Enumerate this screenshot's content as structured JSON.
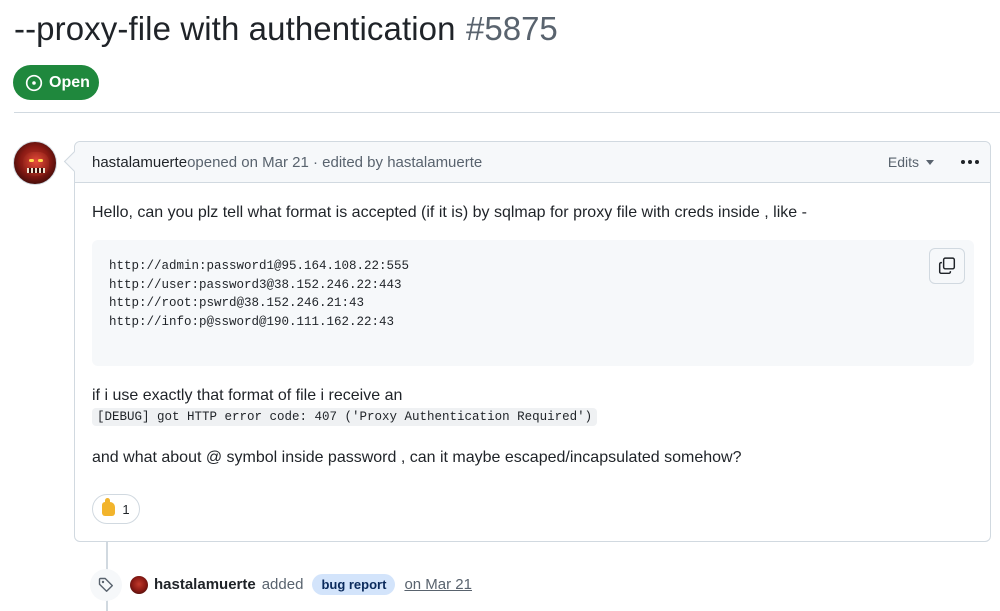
{
  "issue": {
    "title": "--proxy-file with authentication",
    "number": "#5875",
    "state": "Open"
  },
  "comment": {
    "author": "hastalamuerte",
    "meta": " opened on Mar 21 · edited by hastalamuerte",
    "edits_label": "Edits",
    "paragraph1": "Hello, can you plz tell what format is accepted (if it is) by sqlmap for proxy file with creds inside , like -",
    "code_lines": [
      "http://admin:password1@95.164.108.22:555",
      "http://user:password3@38.152.246.22:443",
      "http://root:pswrd@38.152.246.21:43",
      "http://info:p@ssword@190.111.162.22:43"
    ],
    "paragraph2": "if i use exactly that format of file i receive an",
    "inline_code": "[DEBUG] got HTTP error code: 407 ('Proxy Authentication Required')",
    "paragraph3": "and what about @ symbol inside password , can it maybe escaped/incapsulated somehow?",
    "reaction_count": "1"
  },
  "event": {
    "author": "hastalamuerte",
    "action": "added",
    "label": "bug report",
    "date": "on Mar 21"
  },
  "colors": {
    "open_green": "#1f883d",
    "label_bg": "#d3e4fb",
    "border": "#d1d9e0"
  }
}
